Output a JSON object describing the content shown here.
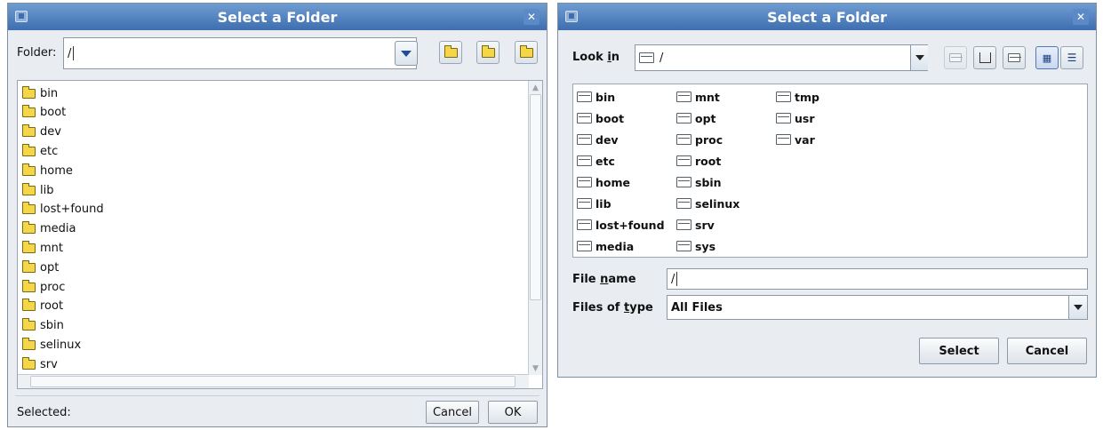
{
  "left_dialog": {
    "title": "Select a Folder",
    "folder_label": "Folder:",
    "folder_value": "/",
    "folders": [
      "bin",
      "boot",
      "dev",
      "etc",
      "home",
      "lib",
      "lost+found",
      "media",
      "mnt",
      "opt",
      "proc",
      "root",
      "sbin",
      "selinux",
      "srv"
    ],
    "selected_label": "Selected:",
    "selected_value": "",
    "cancel_label": "Cancel",
    "ok_label": "OK"
  },
  "right_dialog": {
    "title": "Select a Folder",
    "look_in_label": "Look in",
    "look_in_value": "/",
    "folders": [
      "bin",
      "boot",
      "dev",
      "etc",
      "home",
      "lib",
      "lost+found",
      "media",
      "mnt",
      "opt",
      "proc",
      "root",
      "sbin",
      "selinux",
      "srv",
      "sys",
      "tmp",
      "usr",
      "var"
    ],
    "file_name_label": "File name",
    "file_name_value": "/",
    "files_of_type_label": "Files of type",
    "files_of_type_value": "All Files",
    "select_label": "Select",
    "cancel_label": "Cancel"
  },
  "colors": {
    "titlebar": "#3e6eb0",
    "folder_yellow": "#f5d649",
    "dialog_bg": "#e9edf1"
  }
}
